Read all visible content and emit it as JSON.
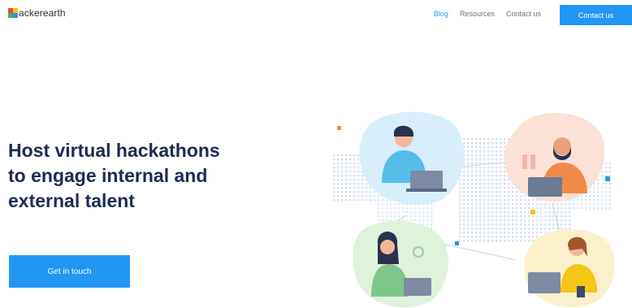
{
  "header": {
    "logo_text": "ackerearth",
    "nav": [
      {
        "label": "Blog",
        "active": true
      },
      {
        "label": "Resources",
        "active": false
      },
      {
        "label": "Contact us",
        "active": false
      }
    ],
    "cta_label": "Contact us"
  },
  "hero": {
    "headline_lines": [
      "Host virtual hackathons",
      "to engage internal and",
      "external talent"
    ],
    "cta_label": "Get in touch"
  },
  "colors": {
    "accent": "#2196f3",
    "headline": "#1d2b55",
    "blob_blue": "#d8eefa",
    "blob_peach": "#fbe1d6",
    "blob_green": "#dff2dc",
    "blob_yellow": "#fcf0cc"
  },
  "icons": [
    "logo-mark-icon",
    "world-map-illustration"
  ]
}
